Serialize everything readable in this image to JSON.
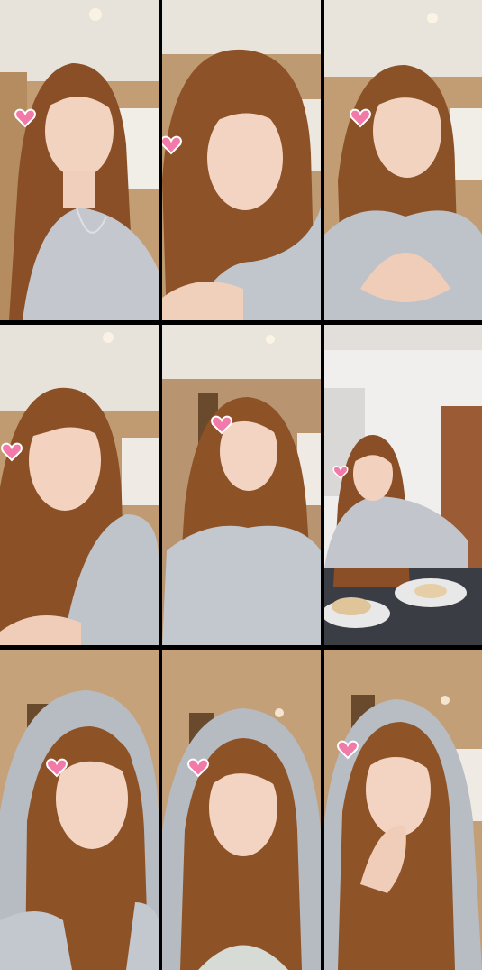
{
  "collage": {
    "rows": 3,
    "columns": 3,
    "tiles": [
      {
        "id": 1,
        "scene": "living-room",
        "hood": false,
        "heart": true
      },
      {
        "id": 2,
        "scene": "living-room",
        "hood": false,
        "heart": true
      },
      {
        "id": 3,
        "scene": "living-room",
        "hood": false,
        "heart": true
      },
      {
        "id": 4,
        "scene": "living-room",
        "hood": false,
        "heart": true
      },
      {
        "id": 5,
        "scene": "living-room",
        "hood": false,
        "heart": true
      },
      {
        "id": 6,
        "scene": "dining-table-dumplings",
        "hood": false,
        "heart": true
      },
      {
        "id": 7,
        "scene": "living-room",
        "hood": true,
        "heart": true
      },
      {
        "id": 8,
        "scene": "living-room",
        "hood": true,
        "heart": true
      },
      {
        "id": 9,
        "scene": "living-room",
        "hood": true,
        "heart": true
      }
    ],
    "colors": {
      "wall": "#c9a476",
      "ceiling": "#e9e4dc",
      "hair": "#8a4f26",
      "skin": "#f0d0bd",
      "hoodie": "#b9bdc4",
      "heart": "#f27aa8",
      "frame_gap": "#000000"
    }
  }
}
